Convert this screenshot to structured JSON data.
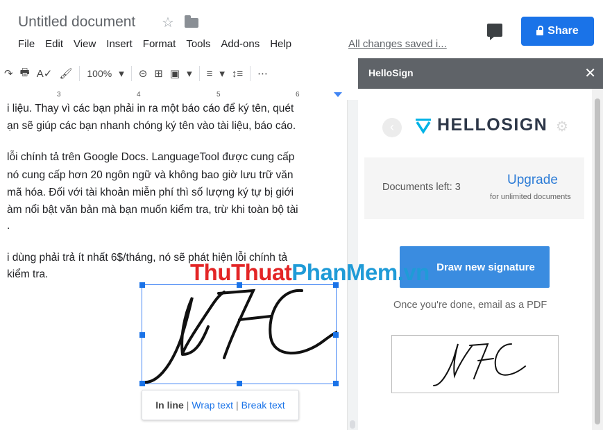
{
  "header": {
    "doc_title": "Untitled document",
    "star_glyph": "☆",
    "saved_status": "All changes saved i...",
    "share_label": "Share",
    "menu": [
      "File",
      "Edit",
      "View",
      "Insert",
      "Format",
      "Tools",
      "Add-ons",
      "Help"
    ]
  },
  "toolbar": {
    "redo": "↷",
    "print": "🖶",
    "spell": "A✓",
    "paint_format": "🖌",
    "zoom": "100%",
    "zoom_caret": "▾",
    "link": "⊝",
    "comment_add": "⊞",
    "image": "▣",
    "image_caret": "▾",
    "align": "≡",
    "align_caret": "▾",
    "line_spacing": "↕≡",
    "more": "⋯"
  },
  "ruler": {
    "marks": [
      "3",
      "4",
      "5",
      "6"
    ]
  },
  "document": {
    "lines": [
      "i liệu. Thay vì các bạn phải in ra một báo cáo để ký tên, quét",
      "ạn sẽ giúp các bạn nhanh chóng ký tên vào tài liệu, báo cáo.",
      "lỗi chính tả trên Google Docs. LanguageTool được cung cấp",
      "nó cung cấp hơn 20 ngôn ngữ và không bao giờ lưu trữ văn",
      "mã hóa. Đối với tài khoản miễn phí thì số lượng ký tự bị giới",
      "àm nổi bật văn bản mà bạn muốn kiểm tra, trừ khi toàn bộ tài",
      ".",
      "i dùng phải trả ít nhất 6$/tháng, nó sẽ phát hiện lỗi chính tả",
      "kiểm tra."
    ]
  },
  "signature": {
    "text": "NTC",
    "popup": {
      "inline": "In line",
      "wrap": "Wrap text",
      "break": "Break text",
      "separator": "|"
    }
  },
  "watermark": {
    "part1": "ThuThuat",
    "part2": "PhanMem.vn"
  },
  "sidebar": {
    "title": "HelloSign",
    "close": "✕",
    "back": "‹",
    "logo_text": "HELLOSIGN",
    "gear": "⚙",
    "docs_left": "Documents left: 3",
    "upgrade": "Upgrade",
    "upgrade_sub": "for unlimited documents",
    "draw_button": "Draw new signature",
    "once_done": "Once you're done, email as a PDF"
  },
  "colors": {
    "share_blue": "#1a73e8",
    "sidebar_header": "#5f6368",
    "draw_button": "#3a8ce0",
    "logo_teal": "#00b3e6",
    "watermark_red": "#e32526",
    "watermark_blue": "#1f9bd7"
  }
}
